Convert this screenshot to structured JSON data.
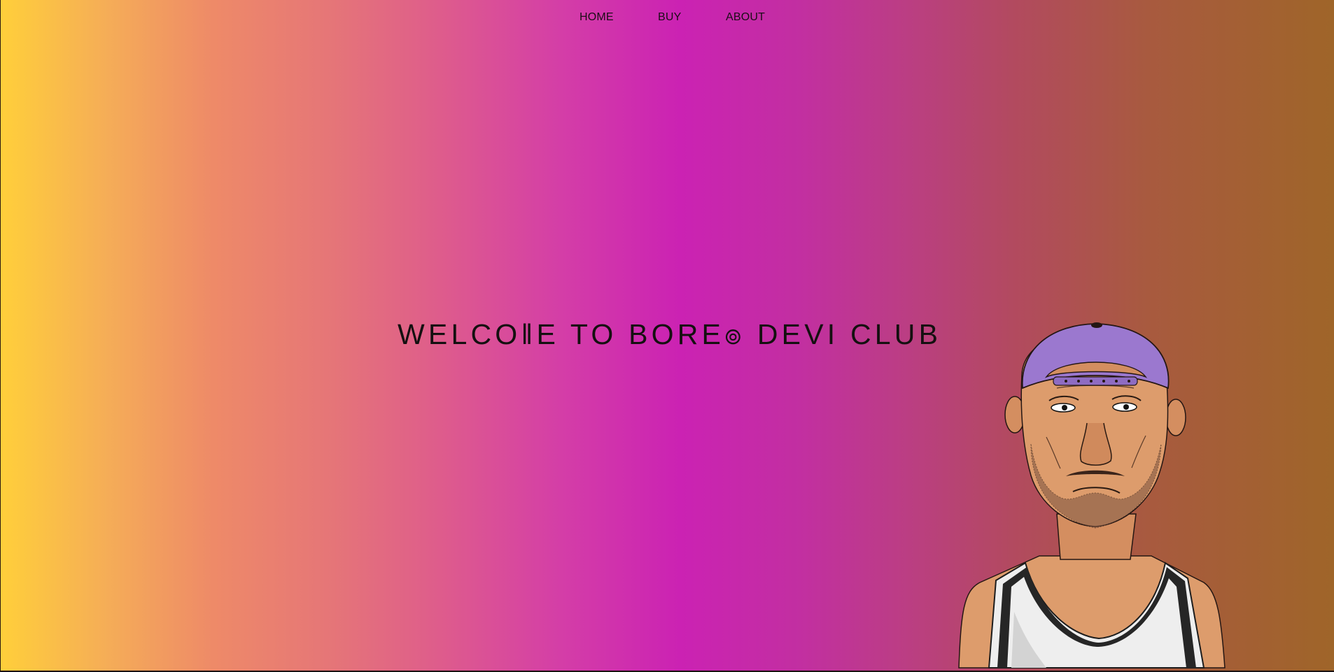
{
  "nav": {
    "home": "HOME",
    "buy": "BUY",
    "about": "ABOUT"
  },
  "hero": {
    "headline": "WELCO‖E TO BORE๏  DEVI  CLUB",
    "image_alt": "Cartoon bald man wearing a backwards purple cap and white tank top"
  },
  "colors": {
    "gradient_left": "#ffcf3a",
    "gradient_mid": "#cb22b3",
    "gradient_right": "#9f6529",
    "cap": "#9b78cf",
    "skin": "#dd9c6c",
    "tank_top": "#eeeeee"
  }
}
